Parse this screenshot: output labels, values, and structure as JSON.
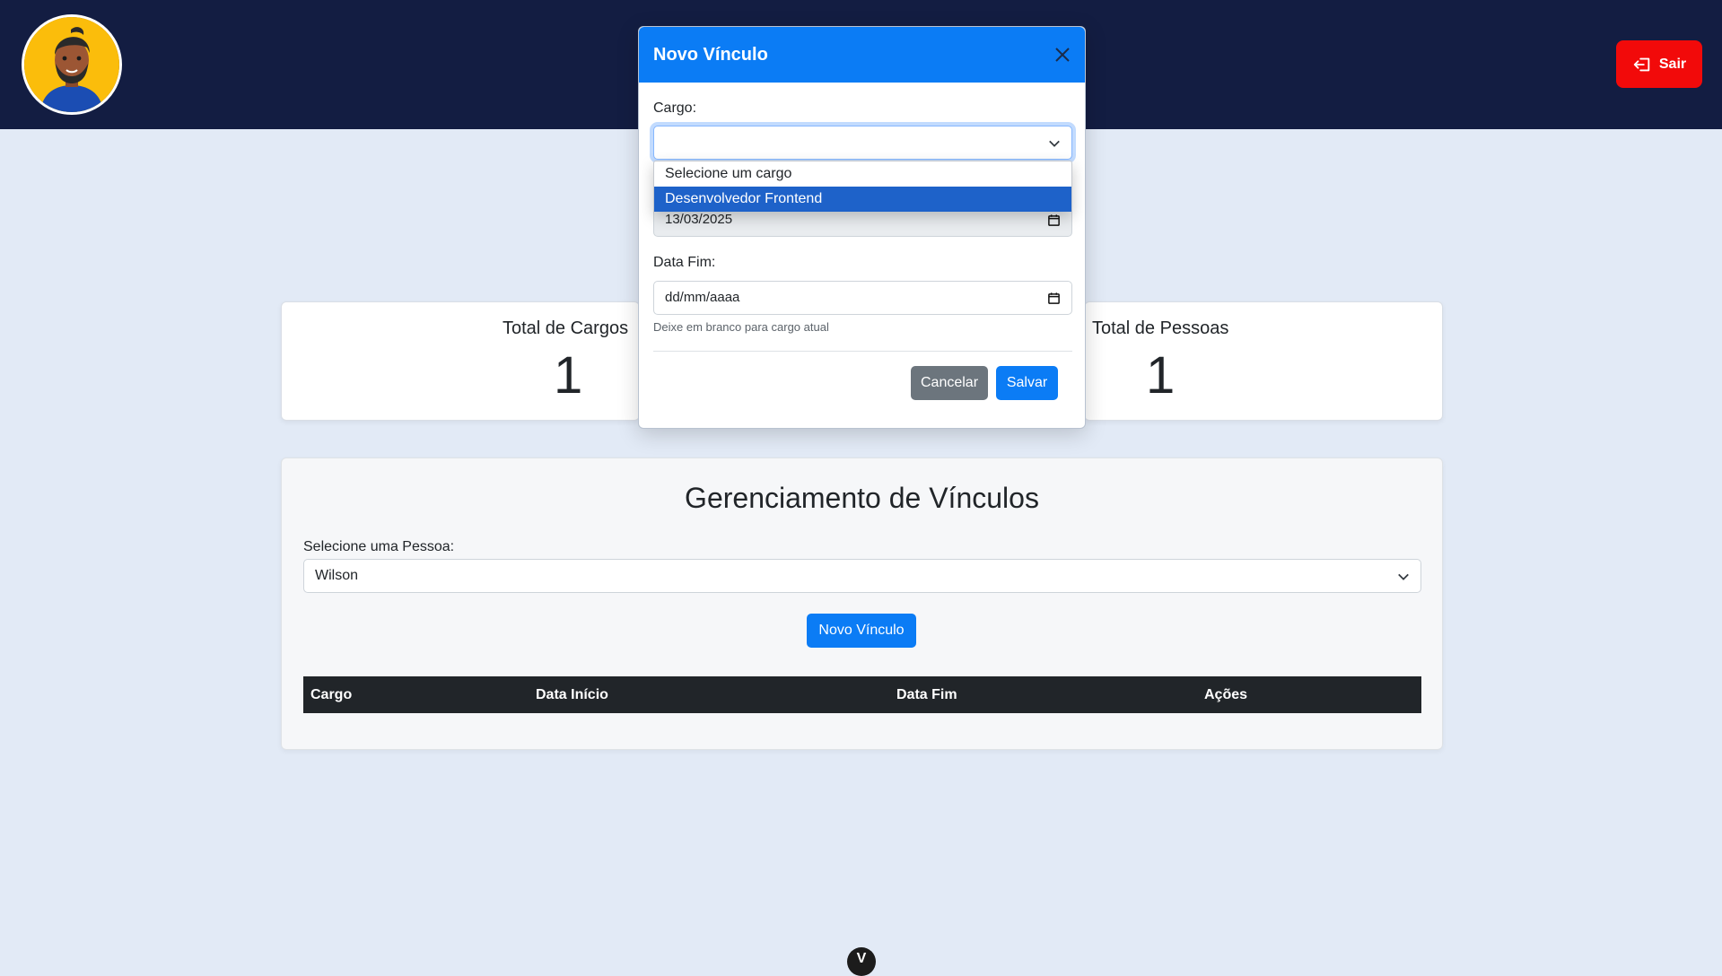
{
  "header": {
    "logout_label": "Sair",
    "avatar_icon": "user-avatar-illustration",
    "logout_icon": "logout-icon"
  },
  "stats": {
    "cargos_title": "Total de Cargos",
    "cargos_value": "1",
    "pessoas_title": "Total de Pessoas",
    "pessoas_value": "1"
  },
  "main": {
    "title": "Gerenciamento de Vínculos",
    "person_label": "Selecione uma Pessoa:",
    "person_selected": "Wilson",
    "new_link_button": "Novo Vínculo",
    "table_headers": [
      "Cargo",
      "Data Início",
      "Data Fim",
      "Ações"
    ]
  },
  "modal": {
    "title": "Novo Vínculo",
    "cargo_label": "Cargo:",
    "cargo_value": "",
    "cargo_options": [
      "Selecione um cargo",
      "Desenvolvedor Frontend"
    ],
    "cargo_highlighted": "Desenvolvedor Frontend",
    "data_inicio_value": "13/03/2025",
    "data_fim_label": "Data Fim:",
    "data_fim_placeholder": "dd/mm/aaaa",
    "data_fim_help": "Deixe em branco para cargo atual",
    "cancel_label": "Cancelar",
    "save_label": "Salvar"
  },
  "floating_badge": "V",
  "colors": {
    "header_bg": "#131d42",
    "primary": "#0b7cf5",
    "danger": "#f20a0a",
    "page_bg": "#e2eaf6",
    "table_header": "#212529"
  }
}
